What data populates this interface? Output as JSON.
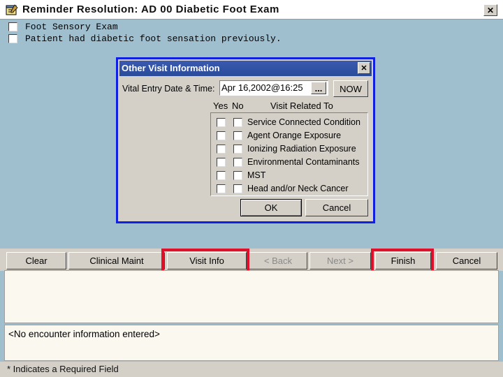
{
  "window": {
    "title": "Reminder Resolution: AD 00 Diabetic Foot Exam",
    "close_glyph": "✕"
  },
  "findings": [
    {
      "label": "Foot Sensory Exam"
    },
    {
      "label": "Patient had diabetic foot sensation previously."
    }
  ],
  "dialog": {
    "title": "Other Visit Information",
    "close_glyph": "✕",
    "date_label": "Vital Entry Date & Time:",
    "date_value": "Apr 16,2002@16:25",
    "ellipsis_label": "...",
    "now_label": "NOW",
    "yes_header": "Yes",
    "no_header": "No",
    "related_header": "Visit Related To",
    "items": [
      {
        "label": "Service Connected Condition"
      },
      {
        "label": "Agent Orange Exposure"
      },
      {
        "label": "Ionizing Radiation Exposure"
      },
      {
        "label": "Environmental Contaminants"
      },
      {
        "label": "MST"
      },
      {
        "label": "Head and/or Neck Cancer"
      }
    ],
    "ok_label": "OK",
    "cancel_label": "Cancel"
  },
  "toolbar": {
    "clear_label": "Clear",
    "clinical_maint_label": "Clinical Maint",
    "visit_info_label": "Visit Info",
    "back_label": "< Back",
    "next_label": "Next >",
    "finish_label": "Finish",
    "cancel_label": "Cancel"
  },
  "encounter_text": "<No encounter information entered>",
  "footer_text": "* Indicates a Required Field",
  "colors": {
    "title_bar": "#2a4a9a",
    "highlight": "#e0102a",
    "dialog_border": "#1020e0"
  }
}
